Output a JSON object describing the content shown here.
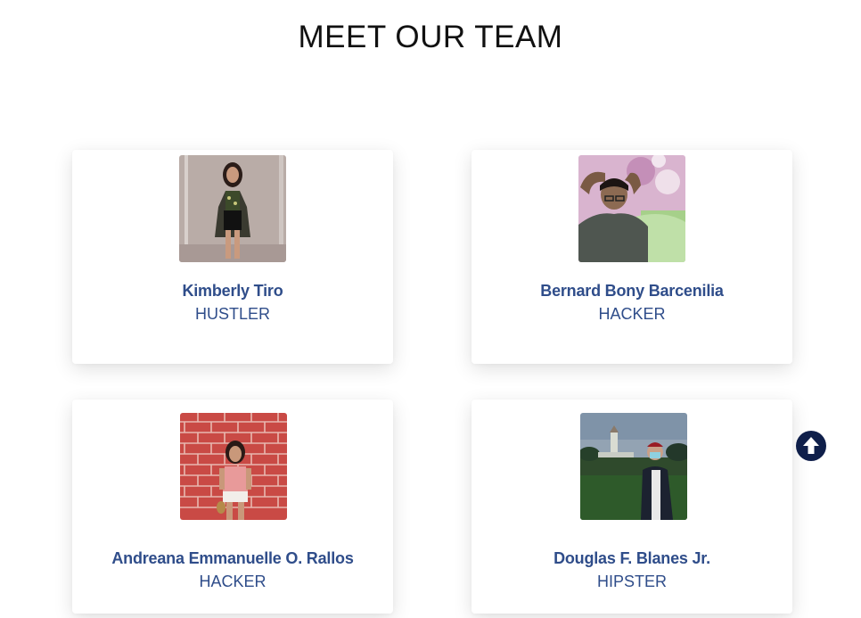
{
  "section": {
    "title": "MEET OUR TEAM"
  },
  "team": [
    {
      "name": "Kimberly Tiro",
      "role": "HUSTLER"
    },
    {
      "name": "Bernard Bony Barcenilia",
      "role": "HACKER"
    },
    {
      "name": "Andreana Emmanuelle O. Rallos",
      "role": "HACKER"
    },
    {
      "name": "Douglas F. Blanes Jr.",
      "role": "HIPSTER"
    }
  ],
  "colors": {
    "name_text": "#2f4d8a",
    "title_text": "#111111",
    "scroll_button": "#0f1f4a"
  },
  "icons": {
    "scroll_top": "arrow-up-circle-icon"
  }
}
